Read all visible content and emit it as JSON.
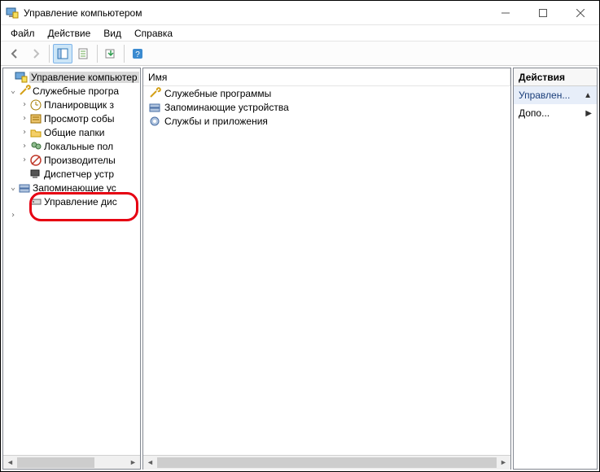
{
  "window": {
    "title": "Управление компьютером"
  },
  "menu": {
    "file": "Файл",
    "action": "Действие",
    "view": "Вид",
    "help": "Справка"
  },
  "tree": {
    "root": "Управление компьютер",
    "utilities": "Служебные програ",
    "scheduler": "Планировщик з",
    "eventviewer": "Просмотр собы",
    "sharedfolders": "Общие папки",
    "localusers": "Локальные пол",
    "performance": "Производителы",
    "devicemgr": "Диспетчер устр",
    "storage": "Запоминающие ус",
    "diskmgmt": "Управление дис",
    "services_row_hidden": ""
  },
  "list": {
    "col_name": "Имя",
    "items": {
      "utilities": "Служебные программы",
      "storage": "Запоминающие устройства",
      "services": "Службы и приложения"
    }
  },
  "actions": {
    "header": "Действия",
    "item_main": "Управлен...",
    "item_more": "Допо..."
  }
}
